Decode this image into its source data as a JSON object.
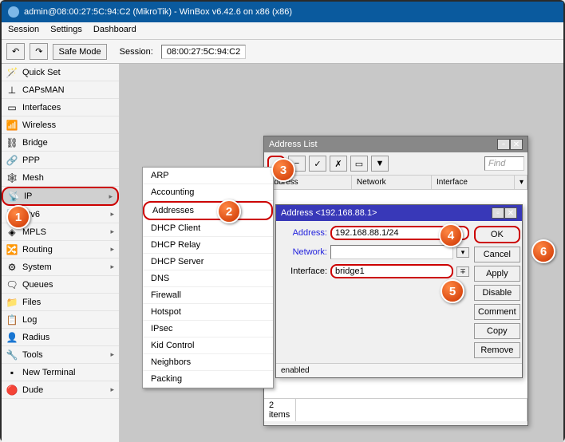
{
  "title": "admin@08:00:27:5C:94:C2 (MikroTik) - WinBox v6.42.6 on x86 (x86)",
  "menu": {
    "session": "Session",
    "settings": "Settings",
    "dashboard": "Dashboard"
  },
  "toolbar": {
    "undo": "↶",
    "redo": "↷",
    "safemode": "Safe Mode",
    "session_label": "Session:",
    "session_value": "08:00:27:5C:94:C2"
  },
  "sidebar": [
    {
      "icon": "🪄",
      "label": "Quick Set"
    },
    {
      "icon": "⊥",
      "label": "CAPsMAN"
    },
    {
      "icon": "▭",
      "label": "Interfaces"
    },
    {
      "icon": "📶",
      "label": "Wireless"
    },
    {
      "icon": "⛓",
      "label": "Bridge"
    },
    {
      "icon": "🔗",
      "label": "PPP"
    },
    {
      "icon": "🕸",
      "label": "Mesh"
    },
    {
      "icon": "📡",
      "label": "IP",
      "sel": true,
      "arrow": true
    },
    {
      "icon": "📡",
      "label": "IPv6",
      "arrow": true
    },
    {
      "icon": "◈",
      "label": "MPLS",
      "arrow": true
    },
    {
      "icon": "🔀",
      "label": "Routing",
      "arrow": true
    },
    {
      "icon": "⚙",
      "label": "System",
      "arrow": true
    },
    {
      "icon": "🗨",
      "label": "Queues"
    },
    {
      "icon": "📁",
      "label": "Files"
    },
    {
      "icon": "📋",
      "label": "Log"
    },
    {
      "icon": "👤",
      "label": "Radius"
    },
    {
      "icon": "🔧",
      "label": "Tools",
      "arrow": true
    },
    {
      "icon": "▪",
      "label": "New Terminal"
    },
    {
      "icon": "🔴",
      "label": "Dude",
      "arrow": true
    }
  ],
  "submenu": [
    "ARP",
    "Accounting",
    "Addresses",
    "DHCP Client",
    "DHCP Relay",
    "DHCP Server",
    "DNS",
    "Firewall",
    "Hotspot",
    "IPsec",
    "Kid Control",
    "Neighbors",
    "Packing"
  ],
  "submenu_sel": 2,
  "addrlist": {
    "title": "Address List",
    "find": "Find",
    "cols": {
      "address": "Address",
      "network": "Network",
      "interface": "Interface"
    },
    "items_count": "2 items",
    "status": "enabled"
  },
  "addrwin": {
    "title": "Address <192.168.88.1>",
    "labels": {
      "address": "Address:",
      "network": "Network:",
      "interface": "Interface:"
    },
    "values": {
      "address": "192.168.88.1/24",
      "network": "",
      "interface": "bridge1"
    },
    "buttons": {
      "ok": "OK",
      "cancel": "Cancel",
      "apply": "Apply",
      "disable": "Disable",
      "comment": "Comment",
      "copy": "Copy",
      "remove": "Remove"
    },
    "footer": "enabled"
  },
  "callouts": {
    "1": "1",
    "2": "2",
    "3": "3",
    "4": "4",
    "5": "5",
    "6": "6"
  }
}
